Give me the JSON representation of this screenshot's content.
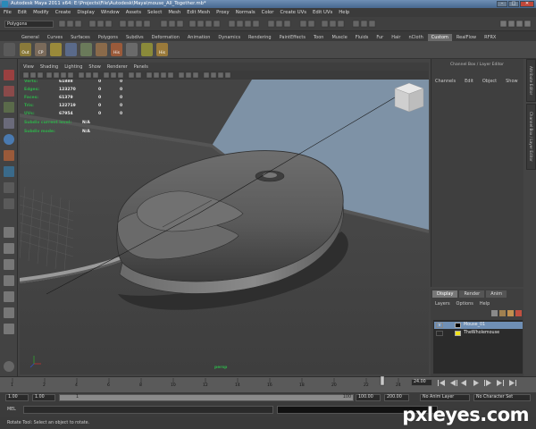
{
  "window": {
    "title": "Autodesk Maya 2011 x64: E:\\Projects\\File\\Autodesk\\Maya\\mouse_All_Together.mb*",
    "min": "–",
    "max": "□",
    "close": "✕"
  },
  "menubar": [
    "File",
    "Edit",
    "Modify",
    "Create",
    "Display",
    "Window",
    "Assets",
    "Select",
    "Mesh",
    "Edit Mesh",
    "Proxy",
    "Normals",
    "Color",
    "Create UVs",
    "Edit UVs",
    "Help"
  ],
  "status": {
    "mode": "Polygons"
  },
  "shelf": {
    "tabs": [
      "General",
      "Curves",
      "Surfaces",
      "Polygons",
      "Subdivs",
      "Deformation",
      "Animation",
      "Dynamics",
      "Rendering",
      "PaintEffects",
      "Toon",
      "Muscle",
      "Fluids",
      "Fur",
      "Hair",
      "nCloth",
      "Custom",
      "RealFlow",
      "RFRX"
    ],
    "active_tab": "Custom",
    "icons": [
      {
        "label": "Out"
      },
      {
        "label": "CP"
      },
      {
        "label": "His"
      },
      {
        "label": "His"
      }
    ]
  },
  "viewport": {
    "menu": [
      "View",
      "Shading",
      "Lighting",
      "Show",
      "Renderer",
      "Panels"
    ],
    "camera_label": "persp",
    "hud": [
      {
        "label": "Verts:",
        "values": [
          "61888",
          "0",
          "0"
        ]
      },
      {
        "label": "Edges:",
        "values": [
          "123270",
          "0",
          "0"
        ]
      },
      {
        "label": "Faces:",
        "values": [
          "61379",
          "0",
          "0"
        ]
      },
      {
        "label": "Tris:",
        "values": [
          "122719",
          "0",
          "0"
        ]
      },
      {
        "label": "UVs:",
        "values": [
          "67954",
          "0",
          "0"
        ]
      },
      {
        "label": "Subdiv current level:",
        "values": [
          "N/A"
        ]
      },
      {
        "label": "Subdiv mode:",
        "values": [
          "N/A"
        ]
      }
    ]
  },
  "channel_box": {
    "title": "Channel Box / Layer Editor",
    "menu": [
      "Channels",
      "Edit",
      "Object",
      "Show"
    ]
  },
  "side_tabs": {
    "attribute_editor": "Attribute Editor",
    "channel_layer": "Channel Box / Layer Editor"
  },
  "layer_editor": {
    "tabs": [
      "Display",
      "Render",
      "Anim"
    ],
    "menu": [
      "Layers",
      "Options",
      "Help"
    ],
    "layers": [
      {
        "visible": "V",
        "color": "#000000",
        "name": "Mouse_01",
        "selected": true
      },
      {
        "visible": "",
        "color": "#f2e31a",
        "name": "TheWholemouse",
        "selected": false
      }
    ]
  },
  "time_slider": {
    "ticks": [
      "1",
      "2",
      "4",
      "6",
      "8",
      "10",
      "12",
      "14",
      "16",
      "18",
      "20",
      "22",
      "24"
    ],
    "current": "24.00"
  },
  "range": {
    "start": "1.00",
    "playstart": "1.00",
    "current_field": "1",
    "range_end_marker": "100",
    "end": "100.00",
    "playend": "200.00",
    "anim_layer": "No Anim Layer",
    "char_set": "No Character Set"
  },
  "command": {
    "label": "MEL"
  },
  "help_line": "Rotate Tool: Select an object to rotate.",
  "watermark": "pxleyes.com"
}
